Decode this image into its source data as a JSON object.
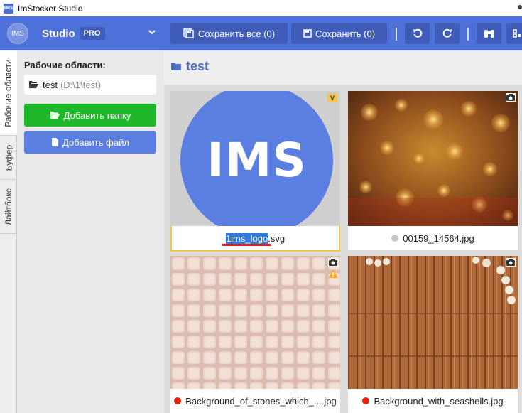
{
  "window": {
    "title": "ImStocker Studio",
    "icon_text": "IMS"
  },
  "brand": {
    "logo": "IMS",
    "name": "Studio",
    "tier": "PRO"
  },
  "toolbar": {
    "save_all_label": "Сохранить все (0)",
    "save_label": "Сохранить (0)",
    "icons": [
      "undo-icon",
      "redo-icon",
      "binoculars-icon",
      "qr-icon"
    ]
  },
  "vertical_tabs": [
    "Рабочие области",
    "Буфер",
    "Лайтбокс"
  ],
  "sidebar": {
    "title": "Рабочие области:",
    "workspace": {
      "name": "test",
      "path": "(D:\\1\\test)"
    },
    "add_folder_label": "Добавить папку",
    "add_file_label": "Добавить файл"
  },
  "main": {
    "folder_name": "test",
    "items": [
      {
        "name_highlighted": "1ims_logo",
        "name_rest": ".svg",
        "status": "selected",
        "badge": "V",
        "thumb_text": "IMS"
      },
      {
        "name": "00159_14564.jpg",
        "status_color": "#c8c8c8",
        "badge": "camera-icon"
      },
      {
        "name": "Background_of_stones_which_....jpg",
        "status_color": "#e62010",
        "badge": "camera-icon",
        "warning": "warning-icon"
      },
      {
        "name": "Background_with_seashells.jpg",
        "status_color": "#e62010",
        "badge": "camera-icon"
      }
    ]
  },
  "colors": {
    "accent": "#4e70d9",
    "accent_dark": "#3f5cb8",
    "green": "#1fb82b",
    "selection": "#f4c542"
  }
}
